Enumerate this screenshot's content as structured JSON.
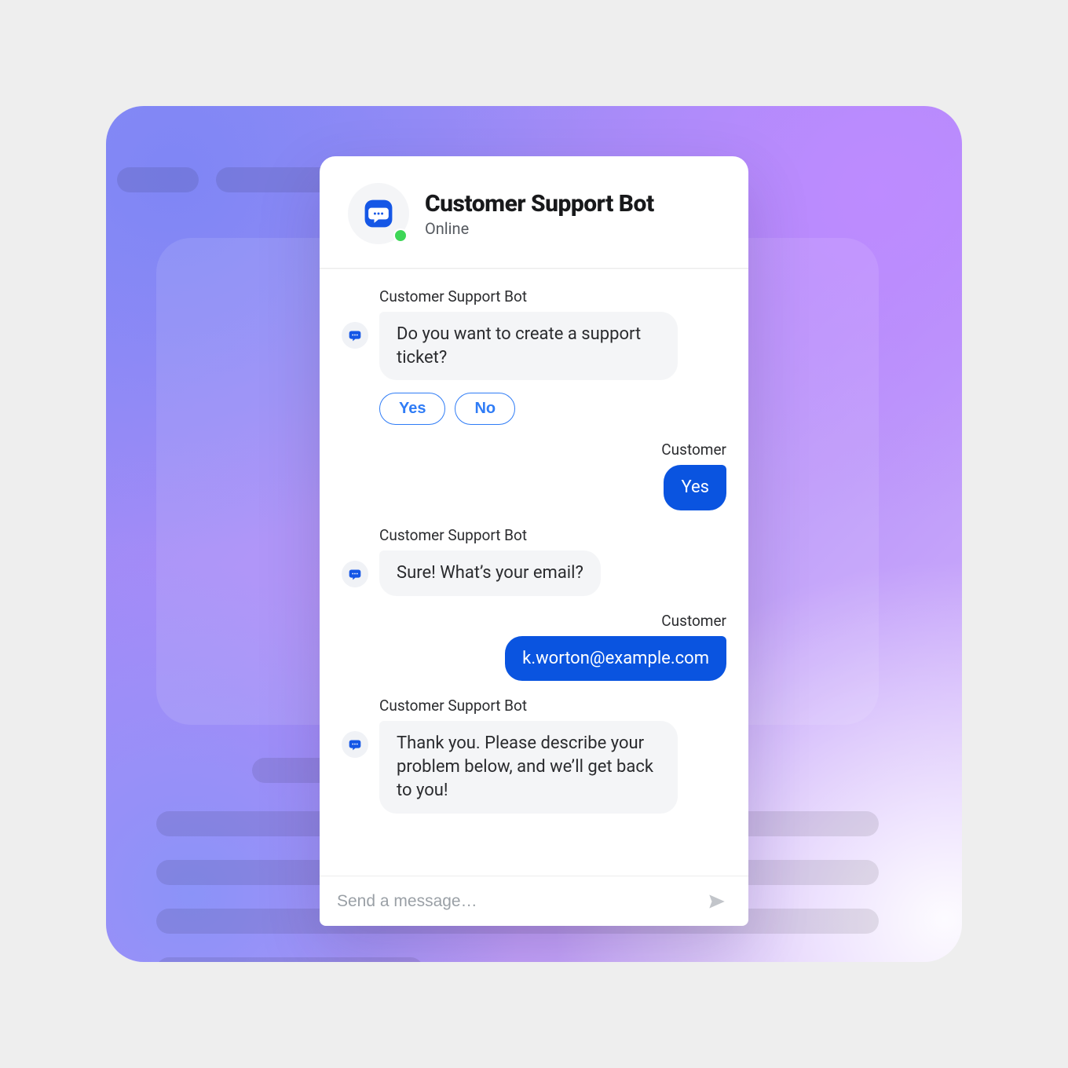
{
  "header": {
    "title": "Customer Support Bot",
    "status": "Online"
  },
  "labels": {
    "bot_sender": "Customer Support Bot",
    "user_sender": "Customer"
  },
  "messages": {
    "m1": "Do you want to create a support ticket?",
    "m2": "Yes",
    "m3": "Sure! What’s your email?",
    "m4": "k.worton@example.com",
    "m5": "Thank you. Please describe your problem below, and we’ll get back to you!"
  },
  "quick_replies": {
    "yes": "Yes",
    "no": "No"
  },
  "composer": {
    "placeholder": "Send a message…"
  },
  "colors": {
    "accent": "#0a54e0",
    "accent_light": "#2f7cf6",
    "presence": "#3ed657"
  },
  "icons": {
    "chat": "chat-bubble-icon",
    "send": "send-icon"
  }
}
